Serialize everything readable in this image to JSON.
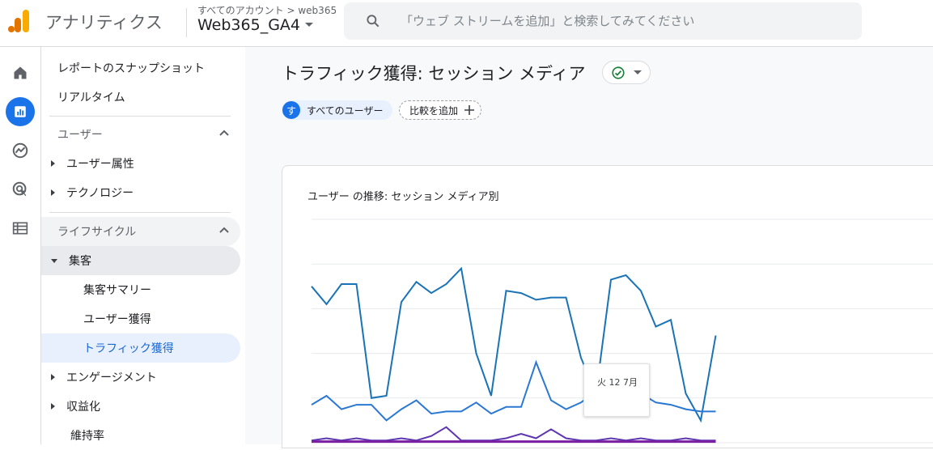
{
  "header": {
    "app_name": "アナリティクス",
    "breadcrumb": "すべてのアカウント > web365",
    "property": "Web365_GA4",
    "search_placeholder": "「ウェブ ストリームを追加」と検索してみてください"
  },
  "rail": {
    "items": [
      "home-icon",
      "reports-icon",
      "explore-icon",
      "advertising-icon",
      "configure-icon"
    ],
    "active_index": 1
  },
  "nav": {
    "snapshot": "レポートのスナップショット",
    "realtime": "リアルタイム",
    "user_section": "ユーザー",
    "user_attributes": "ユーザー属性",
    "technology": "テクノロジー",
    "lifecycle_section": "ライフサイクル",
    "acquisition": "集客",
    "acquisition_overview": "集客サマリー",
    "user_acquisition": "ユーザー獲得",
    "traffic_acquisition": "トラフィック獲得",
    "engagement": "エンゲージメント",
    "monetization": "収益化",
    "retention": "維持率"
  },
  "main": {
    "title": "トラフィック獲得: セッション メディア",
    "segment_avatar": "す",
    "segment_label": "すべてのユーザー",
    "compare_label": "比較を追加",
    "card_title": "ユーザー の推移: セッション メディア別",
    "tooltip": "火 12 7月"
  },
  "colors": {
    "accent": "#1a73e8",
    "series_1": "#1a73b6",
    "series_2": "#2a78d4",
    "series_3": "#5e35b1",
    "series_4": "#7b1fa2"
  },
  "chart_data": {
    "type": "line",
    "title": "ユーザー の推移: セッション メディア別",
    "x_count": 34,
    "ylim": [
      0,
      100
    ],
    "grid": true,
    "series": [
      {
        "values": [
          70,
          62,
          71,
          71,
          20,
          21,
          63,
          72,
          67,
          71,
          78,
          40,
          21,
          68,
          67,
          64,
          65,
          65,
          38,
          22,
          73,
          75,
          68,
          52,
          55,
          22,
          10,
          48
        ]
      },
      {
        "values": [
          17,
          21,
          15,
          17,
          17,
          10,
          15,
          19,
          13,
          14,
          14,
          18,
          13,
          16,
          16,
          36,
          19,
          15,
          18,
          23,
          24,
          15,
          22,
          18,
          17,
          15,
          14,
          14
        ]
      },
      {
        "values": [
          1,
          2,
          1,
          2,
          1,
          1,
          2,
          1,
          3,
          7,
          1,
          1,
          1,
          2,
          4,
          2,
          6,
          2,
          1,
          1,
          2,
          1,
          2,
          1,
          1,
          2,
          1,
          1
        ]
      },
      {
        "values": [
          0.5,
          0.5,
          0.5,
          0.5,
          0.5,
          0.5,
          0.5,
          0.5,
          0.5,
          0.5,
          0.5,
          0.5,
          0.5,
          0.5,
          0.5,
          0.5,
          0.5,
          0.5,
          0.5,
          0.5,
          0.5,
          0.5,
          0.5,
          0.5,
          0.5,
          0.5,
          0.5,
          0.5
        ]
      }
    ]
  }
}
